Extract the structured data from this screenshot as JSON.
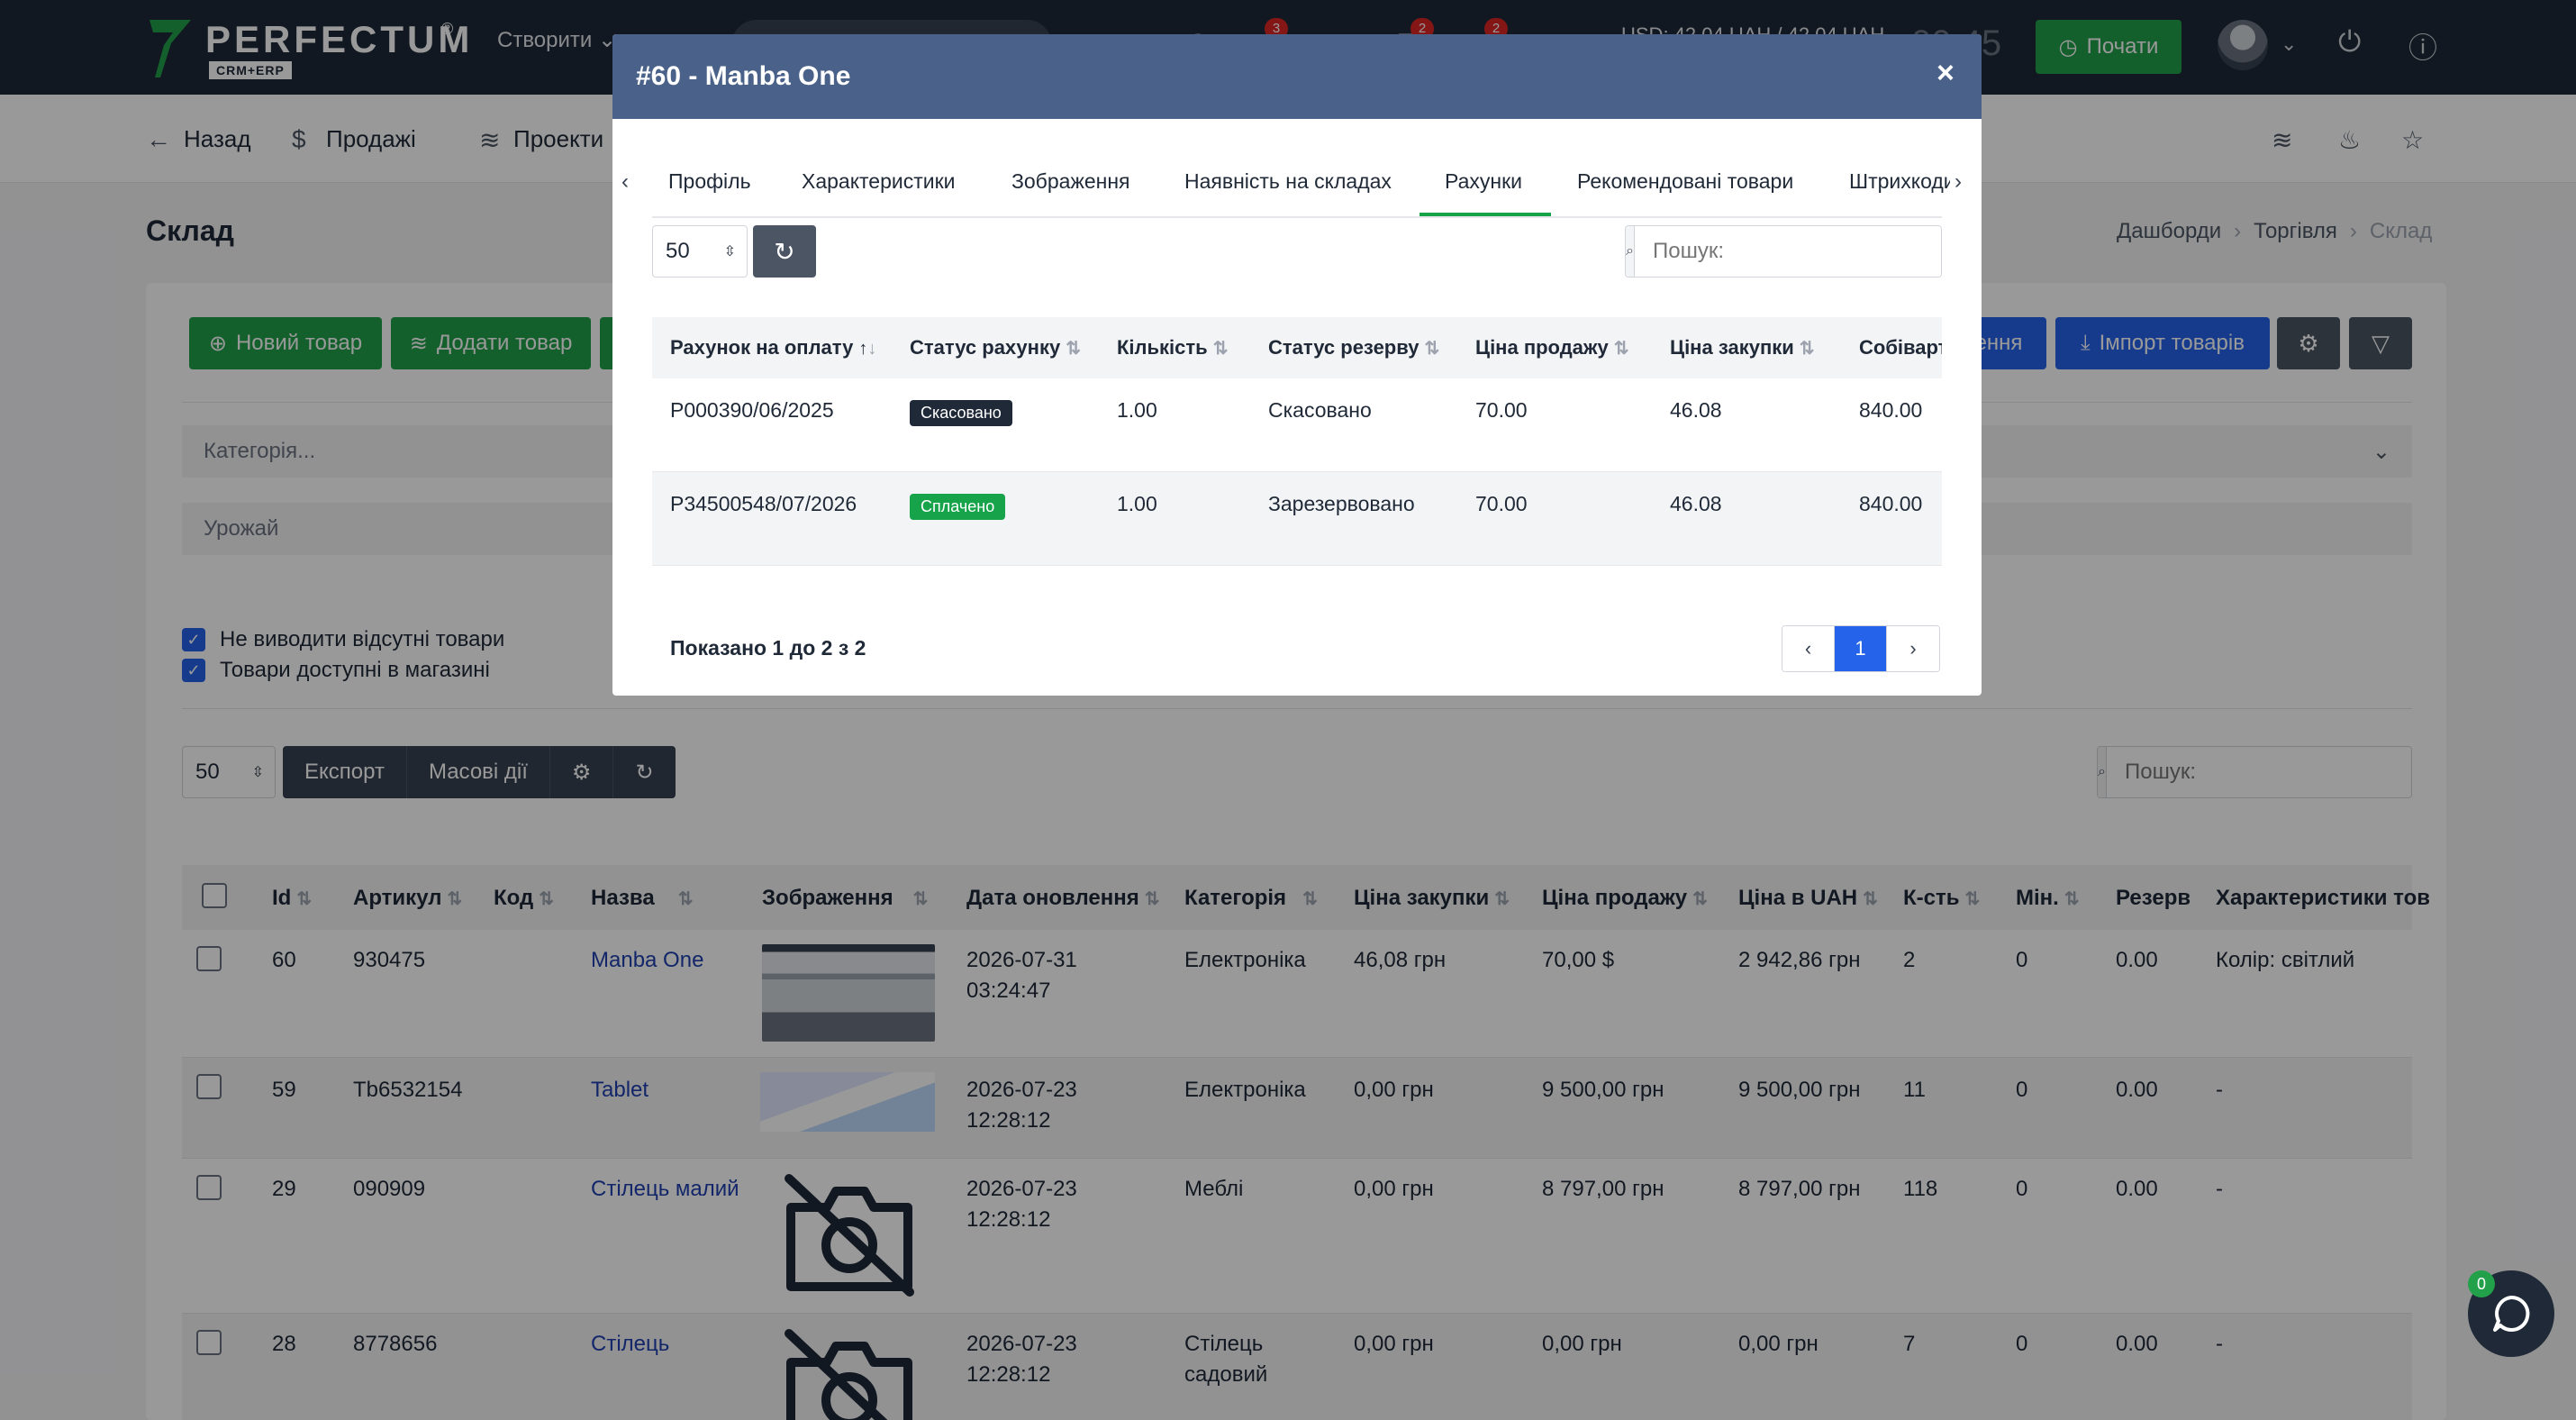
{
  "brand": {
    "name": "PERFECTUM",
    "reg": "®",
    "sub": "CRM+ERP",
    "color": "#22a14a"
  },
  "topbar": {
    "create_label": "Створити",
    "badges": [
      "3",
      "2",
      "2"
    ],
    "currency": "USD: 42,04 UAH / 42,04 UAH",
    "time": "00:45",
    "start_label": "Почати"
  },
  "subbar": {
    "back_label": "Назад",
    "sales_label": "Продажі",
    "projects_label": "Проекти"
  },
  "page": {
    "title": "Склад",
    "breadcrumb": [
      "Дашборди",
      "Торгівля",
      "Склад"
    ]
  },
  "toolbar": {
    "new_product": "Новий товар",
    "add_product": "Додати товар",
    "update_label": "ення",
    "import_label": "Імпорт товарів"
  },
  "filters": {
    "category_placeholder": "Категорія...",
    "harvest_placeholder": "Урожай",
    "hide_missing": "Не виводити відсутні товари",
    "available_in_store": "Товари доступні в магазині"
  },
  "list_controls": {
    "page_size": "50",
    "export_label": "Експорт",
    "bulk_label": "Масові дії",
    "search_placeholder": "Пошук:"
  },
  "main_table": {
    "headers": [
      "Id",
      "Артикул",
      "Код",
      "Назва",
      "Зображення",
      "Дата оновлення",
      "Категорія",
      "Ціна закупки",
      "Ціна продажу",
      "Ціна в UAH",
      "К-сть",
      "Мін.",
      "Резерв",
      "Характеристики тов"
    ],
    "rows": [
      {
        "id": "60",
        "sku": "930475",
        "code": "",
        "name": "Manba One",
        "date1": "2026-07-31",
        "date2": "03:24:47",
        "category": "Електроніка",
        "cat2": "",
        "buy": "46,08 грн",
        "sell": "70,00 $",
        "uah": "2 942,86 грн",
        "qty": "2",
        "min": "0",
        "reserve": "0.00",
        "chars": "Колір: світлий"
      },
      {
        "id": "59",
        "sku": "Tb6532154",
        "code": "",
        "name": "Tablet",
        "date1": "2026-07-23",
        "date2": "12:28:12",
        "category": "Електроніка",
        "cat2": "",
        "buy": "0,00 грн",
        "sell": "9 500,00 грн",
        "uah": "9 500,00 грн",
        "qty": "11",
        "min": "0",
        "reserve": "0.00",
        "chars": "-"
      },
      {
        "id": "29",
        "sku": "090909",
        "code": "",
        "name": "Стілець малий",
        "date1": "2026-07-23",
        "date2": "12:28:12",
        "category": "Меблі",
        "cat2": "",
        "buy": "0,00 грн",
        "sell": "8 797,00 грн",
        "uah": "8 797,00 грн",
        "qty": "118",
        "min": "0",
        "reserve": "0.00",
        "chars": "-"
      },
      {
        "id": "28",
        "sku": "8778656",
        "code": "",
        "name": "Стілець",
        "date1": "2026-07-23",
        "date2": "12:28:12",
        "category": "Стілець",
        "cat2": "садовий",
        "buy": "0,00 грн",
        "sell": "0,00 грн",
        "uah": "0,00 грн",
        "qty": "7",
        "min": "0",
        "reserve": "0.00",
        "chars": "-"
      }
    ]
  },
  "chat": {
    "badge": "0"
  },
  "modal": {
    "title": "#60 - Manba One",
    "close": "×",
    "tabs": [
      "Профіль",
      "Характеристики",
      "Зображення",
      "Наявність на складах",
      "Рахунки",
      "Рекомендовані товари",
      "Штрихкоди"
    ],
    "active_tab": "Рахунки",
    "page_size": "50",
    "search_placeholder": "Пошук:",
    "headers": [
      "Рахунок на оплату",
      "Статус рахунку",
      "Кількість",
      "Статус резерву",
      "Ціна продажу",
      "Ціна закупки",
      "Собіварт"
    ],
    "rows": [
      {
        "invoice": "P000390/06/2025",
        "status": "Скасовано",
        "status_color": "#1f2937",
        "qty": "1.00",
        "reserve": "Скасовано",
        "sell": "70.00",
        "buy": "46.08",
        "cost": "840.00"
      },
      {
        "invoice": "P34500548/07/2026",
        "status": "Сплачено",
        "status_color": "#16a34a",
        "qty": "1.00",
        "reserve": "Зарезервовано",
        "sell": "70.00",
        "buy": "46.08",
        "cost": "840.00"
      }
    ],
    "summary": "Показано 1 до 2 з 2",
    "page": "1"
  }
}
